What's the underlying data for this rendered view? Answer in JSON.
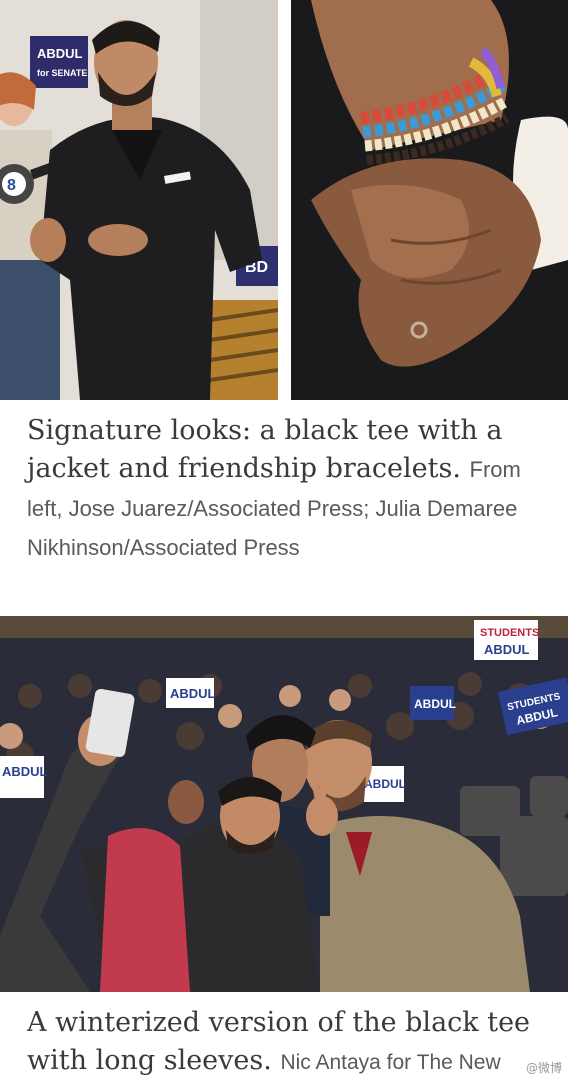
{
  "photos": {
    "left": {
      "sign_line1": "ABDUL",
      "sign_line2": "for SENATE",
      "banner_fragment": "BD"
    },
    "bottom": {
      "signs": [
        {
          "line1": "ABDUL",
          "line2": ""
        },
        {
          "line1": "STUDENTS",
          "line2": "ABDUL"
        },
        {
          "line1": "ABDUL",
          "line2": ""
        },
        {
          "line1": "ABDUL",
          "line2": ""
        },
        {
          "line1": "STUDENTS",
          "line2": "ABDUL"
        },
        {
          "line1": "ABDUL",
          "line2": ""
        }
      ]
    }
  },
  "caption_1": {
    "text": "Signature looks: a black tee with a jacket and friendship bracelets.",
    "credit": "From left, Jose Juarez/Associated Press; Julia Demaree Nikhinson/Associated Press"
  },
  "caption_2": {
    "text": "A winterized version of the black tee with long sleeves.",
    "credit": "Nic Antaya for The New"
  },
  "watermark": "@微博"
}
